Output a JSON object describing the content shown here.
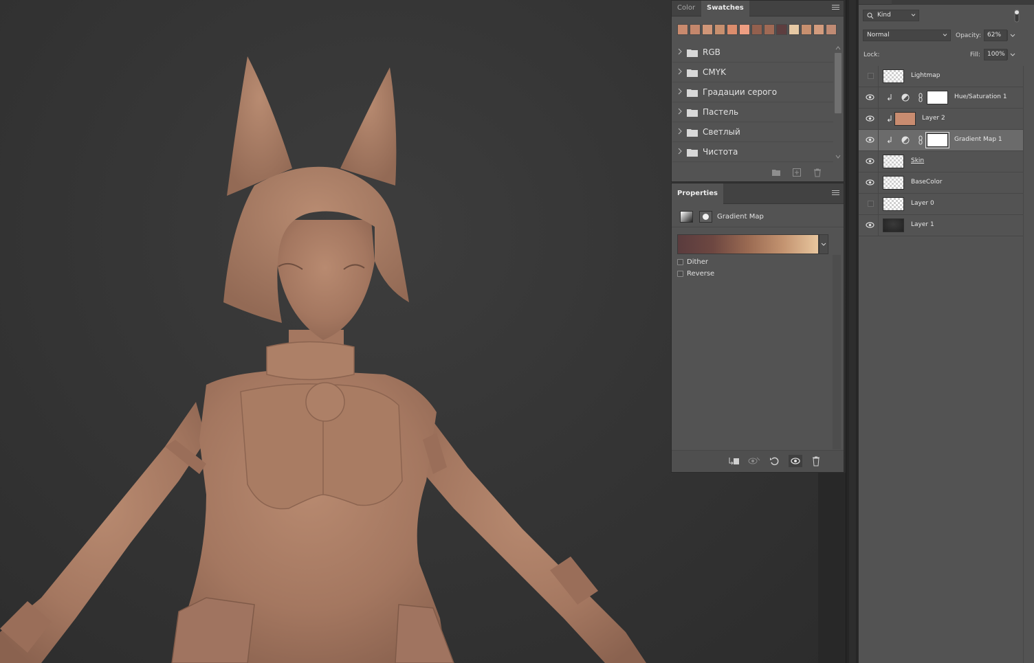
{
  "swatches_panel": {
    "tabs": [
      {
        "label": "Color",
        "active": false
      },
      {
        "label": "Swatches",
        "active": true
      }
    ],
    "swatch_colors": [
      "#c98a6e",
      "#c4876c",
      "#d09678",
      "#c8906f",
      "#dc8d6d",
      "#ee9e82",
      "#93604e",
      "#a06a55",
      "#5d3e3f",
      "#e6c9a4",
      "#c8906f",
      "#d39c7e",
      "#c08b74"
    ],
    "groups": [
      {
        "name": "RGB"
      },
      {
        "name": "CMYK"
      },
      {
        "name": "Градации серого"
      },
      {
        "name": "Пастель"
      },
      {
        "name": "Светлый"
      },
      {
        "name": "Чистота"
      }
    ]
  },
  "properties_panel": {
    "tab_label": "Properties",
    "title": "Gradient Map",
    "gradient_colors": [
      "#5a3c3e",
      "#6d4741",
      "#9a6a52",
      "#c39370",
      "#e8c69e"
    ],
    "dither_label": "Dither",
    "dither_checked": false,
    "reverse_label": "Reverse",
    "reverse_checked": false
  },
  "layers_panel": {
    "filter_kind": "Kind",
    "blend_mode": "Normal",
    "opacity_label": "Opacity:",
    "opacity_value": "62%",
    "lock_label": "Lock:",
    "fill_label": "Fill:",
    "fill_value": "100%",
    "layers": [
      {
        "name": "Lightmap",
        "visible": false,
        "type": "pixel",
        "thumb": "checker",
        "selected": false
      },
      {
        "name": "Hue/Saturation 1",
        "visible": true,
        "type": "adjustment",
        "clipped": true,
        "selected": false
      },
      {
        "name": "Layer 2",
        "visible": true,
        "type": "fill",
        "clipped": true,
        "thumb_color": "#c98c70",
        "selected": false
      },
      {
        "name": "Gradient Map 1",
        "visible": true,
        "type": "adjustment",
        "clipped": true,
        "selected": true
      },
      {
        "name": "Skin",
        "visible": true,
        "type": "pixel",
        "thumb": "checker",
        "selected": false
      },
      {
        "name": "BaseColor",
        "visible": true,
        "type": "pixel",
        "thumb": "checker",
        "selected": false
      },
      {
        "name": "Layer 0",
        "visible": false,
        "type": "pixel",
        "thumb": "checker",
        "selected": false
      },
      {
        "name": "Layer 1",
        "visible": true,
        "type": "pixel",
        "thumb": "dark",
        "selected": false
      }
    ]
  },
  "canvas": {
    "model_color": "#a87a62"
  }
}
